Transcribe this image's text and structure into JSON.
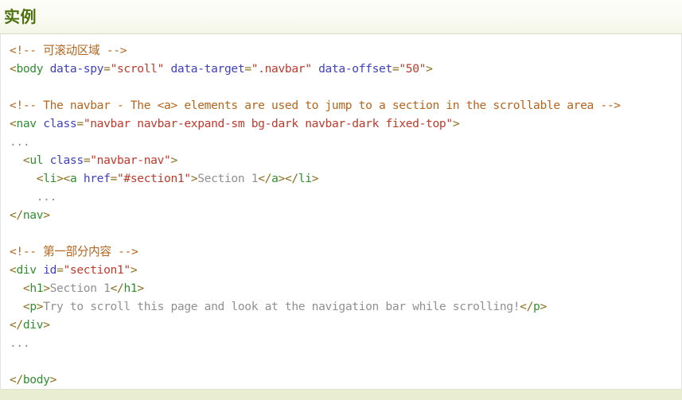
{
  "header": {
    "title": "实例",
    "title_color": "#4f7211",
    "background_color": "#f3f6e8"
  },
  "footer": {
    "background_color": "#e9eed3"
  },
  "syntax_colors": {
    "comment": "#b5651d",
    "tag": "#2f8f2f",
    "attribute": "#4040c0",
    "value": "#c0392b",
    "text": "#909090",
    "punctuation": "#8a6d1a",
    "background": "#ffffff"
  },
  "code": {
    "language": "html",
    "lines": [
      {
        "id": "l1",
        "segments": [
          {
            "cls": "cmt",
            "t": "<!-- 可滚动区域 -->"
          }
        ]
      },
      {
        "id": "l2",
        "segments": [
          {
            "cls": "punct",
            "t": "<"
          },
          {
            "cls": "tag",
            "t": "body"
          },
          {
            "cls": "txt",
            "t": " "
          },
          {
            "cls": "attr",
            "t": "data-spy"
          },
          {
            "cls": "punct",
            "t": "="
          },
          {
            "cls": "val",
            "t": "\"scroll\""
          },
          {
            "cls": "txt",
            "t": " "
          },
          {
            "cls": "attr",
            "t": "data-target"
          },
          {
            "cls": "punct",
            "t": "="
          },
          {
            "cls": "val",
            "t": "\".navbar\""
          },
          {
            "cls": "txt",
            "t": " "
          },
          {
            "cls": "attr",
            "t": "data-offset"
          },
          {
            "cls": "punct",
            "t": "="
          },
          {
            "cls": "val",
            "t": "\"50\""
          },
          {
            "cls": "punct",
            "t": ">"
          }
        ]
      },
      {
        "id": "l3",
        "segments": []
      },
      {
        "id": "l4",
        "segments": [
          {
            "cls": "cmt",
            "t": "<!-- The navbar - The <a> elements are used to jump to a section in the scrollable area -->"
          }
        ]
      },
      {
        "id": "l5",
        "segments": [
          {
            "cls": "punct",
            "t": "<"
          },
          {
            "cls": "tag",
            "t": "nav"
          },
          {
            "cls": "txt",
            "t": " "
          },
          {
            "cls": "attr",
            "t": "class"
          },
          {
            "cls": "punct",
            "t": "="
          },
          {
            "cls": "val",
            "t": "\"navbar navbar-expand-sm bg-dark navbar-dark fixed-top\""
          },
          {
            "cls": "punct",
            "t": ">"
          }
        ]
      },
      {
        "id": "l6",
        "segments": [
          {
            "cls": "dots",
            "t": "..."
          }
        ]
      },
      {
        "id": "l7",
        "segments": [
          {
            "cls": "txt",
            "t": "  "
          },
          {
            "cls": "punct",
            "t": "<"
          },
          {
            "cls": "tag",
            "t": "ul"
          },
          {
            "cls": "txt",
            "t": " "
          },
          {
            "cls": "attr",
            "t": "class"
          },
          {
            "cls": "punct",
            "t": "="
          },
          {
            "cls": "val",
            "t": "\"navbar-nav\""
          },
          {
            "cls": "punct",
            "t": ">"
          }
        ]
      },
      {
        "id": "l8",
        "segments": [
          {
            "cls": "txt",
            "t": "    "
          },
          {
            "cls": "punct",
            "t": "<"
          },
          {
            "cls": "tag",
            "t": "li"
          },
          {
            "cls": "punct",
            "t": ">"
          },
          {
            "cls": "punct",
            "t": "<"
          },
          {
            "cls": "tag",
            "t": "a"
          },
          {
            "cls": "txt",
            "t": " "
          },
          {
            "cls": "attr",
            "t": "href"
          },
          {
            "cls": "punct",
            "t": "="
          },
          {
            "cls": "val",
            "t": "\"#section1\""
          },
          {
            "cls": "punct",
            "t": ">"
          },
          {
            "cls": "txt",
            "t": "Section 1"
          },
          {
            "cls": "punct",
            "t": "</"
          },
          {
            "cls": "tag",
            "t": "a"
          },
          {
            "cls": "punct",
            "t": ">"
          },
          {
            "cls": "punct",
            "t": "</"
          },
          {
            "cls": "tag",
            "t": "li"
          },
          {
            "cls": "punct",
            "t": ">"
          }
        ]
      },
      {
        "id": "l9",
        "segments": [
          {
            "cls": "txt",
            "t": "    "
          },
          {
            "cls": "dots",
            "t": "..."
          }
        ]
      },
      {
        "id": "l10",
        "segments": [
          {
            "cls": "punct",
            "t": "</"
          },
          {
            "cls": "tag",
            "t": "nav"
          },
          {
            "cls": "punct",
            "t": ">"
          }
        ]
      },
      {
        "id": "l11",
        "segments": []
      },
      {
        "id": "l12",
        "segments": [
          {
            "cls": "cmt",
            "t": "<!-- 第一部分内容 -->"
          }
        ]
      },
      {
        "id": "l13",
        "segments": [
          {
            "cls": "punct",
            "t": "<"
          },
          {
            "cls": "tag",
            "t": "div"
          },
          {
            "cls": "txt",
            "t": " "
          },
          {
            "cls": "attr",
            "t": "id"
          },
          {
            "cls": "punct",
            "t": "="
          },
          {
            "cls": "val",
            "t": "\"section1\""
          },
          {
            "cls": "punct",
            "t": ">"
          }
        ]
      },
      {
        "id": "l14",
        "segments": [
          {
            "cls": "txt",
            "t": "  "
          },
          {
            "cls": "punct",
            "t": "<"
          },
          {
            "cls": "tag",
            "t": "h1"
          },
          {
            "cls": "punct",
            "t": ">"
          },
          {
            "cls": "txt",
            "t": "Section 1"
          },
          {
            "cls": "punct",
            "t": "</"
          },
          {
            "cls": "tag",
            "t": "h1"
          },
          {
            "cls": "punct",
            "t": ">"
          }
        ]
      },
      {
        "id": "l15",
        "segments": [
          {
            "cls": "txt",
            "t": "  "
          },
          {
            "cls": "punct",
            "t": "<"
          },
          {
            "cls": "tag",
            "t": "p"
          },
          {
            "cls": "punct",
            "t": ">"
          },
          {
            "cls": "txt",
            "t": "Try to scroll this page and look at the navigation bar while scrolling!"
          },
          {
            "cls": "punct",
            "t": "</"
          },
          {
            "cls": "tag",
            "t": "p"
          },
          {
            "cls": "punct",
            "t": ">"
          }
        ]
      },
      {
        "id": "l16",
        "segments": [
          {
            "cls": "punct",
            "t": "</"
          },
          {
            "cls": "tag",
            "t": "div"
          },
          {
            "cls": "punct",
            "t": ">"
          }
        ]
      },
      {
        "id": "l17",
        "segments": [
          {
            "cls": "dots",
            "t": "..."
          }
        ]
      },
      {
        "id": "l18",
        "segments": []
      },
      {
        "id": "l19",
        "segments": [
          {
            "cls": "punct",
            "t": "</"
          },
          {
            "cls": "tag",
            "t": "body"
          },
          {
            "cls": "punct",
            "t": ">"
          }
        ]
      }
    ]
  }
}
